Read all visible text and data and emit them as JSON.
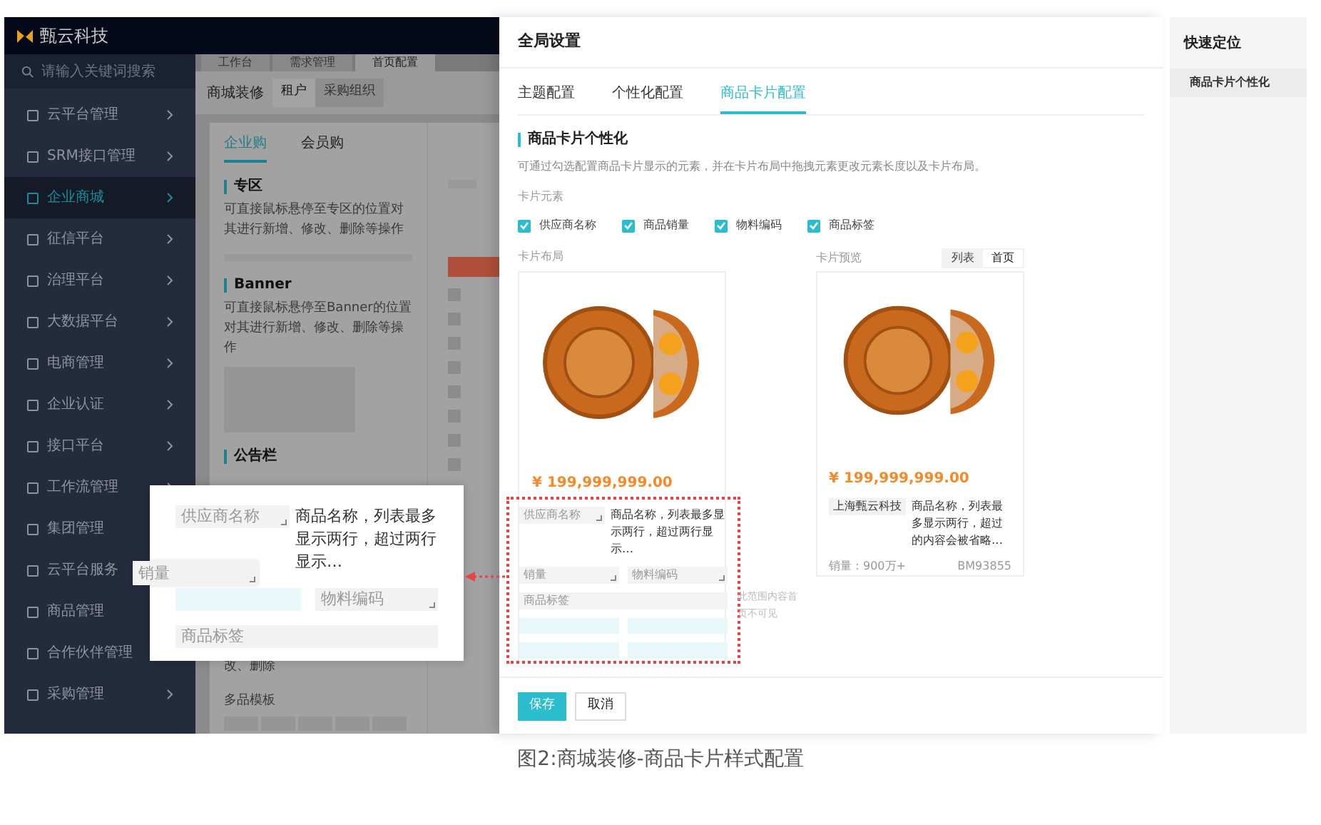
{
  "app": {
    "logo": "甄云科技",
    "search_placeholder": "请输入关键词搜索",
    "sidebar": [
      {
        "label": "云平台管理",
        "selected": false
      },
      {
        "label": "SRM接口管理",
        "selected": false
      },
      {
        "label": "企业商城",
        "selected": true
      },
      {
        "label": "征信平台",
        "selected": false
      },
      {
        "label": "治理平台",
        "selected": false
      },
      {
        "label": "大数据平台",
        "selected": false
      },
      {
        "label": "电商管理",
        "selected": false
      },
      {
        "label": "企业认证",
        "selected": false
      },
      {
        "label": "接口平台",
        "selected": false
      },
      {
        "label": "工作流管理",
        "selected": false
      },
      {
        "label": "集团管理",
        "selected": false
      },
      {
        "label": "云平台服务",
        "selected": false
      },
      {
        "label": "商品管理",
        "selected": false
      },
      {
        "label": "合作伙伴管理",
        "selected": false
      },
      {
        "label": "采购管理",
        "selected": false
      }
    ],
    "breadcrumbs": [
      {
        "label": "工作台",
        "selected": false
      },
      {
        "label": "需求管理",
        "selected": false
      },
      {
        "label": "首页配置",
        "selected": true
      }
    ],
    "page_title": "商城装修",
    "scope_tabs": [
      {
        "label": "租户",
        "selected": true
      },
      {
        "label": "采购组织",
        "selected": false
      }
    ],
    "tabs": [
      {
        "label": "企业购",
        "selected": true
      },
      {
        "label": "会员购",
        "selected": false
      }
    ],
    "sections": [
      {
        "kind": "text",
        "title": "专区",
        "description": "可直接鼠标悬停至专区的位置对其进行新增、修改、删除等操作"
      },
      {
        "kind": "image",
        "title": "Banner",
        "description": "可直接鼠标悬停至Banner的位置对其进行新增、修改、删除等操作"
      },
      {
        "kind": "title",
        "title": "公告栏"
      }
    ],
    "cut_text": "改、删除",
    "template_label": "多品模板"
  },
  "callout": {
    "supplier": "供应商名称",
    "name": "商品名称，列表最多显示两行，超过两行显示…",
    "dragged": "销量",
    "code": "物料编码",
    "tag": "商品标签"
  },
  "drawer": {
    "title": "全局设置",
    "tabs": [
      {
        "label": "主题配置",
        "selected": false
      },
      {
        "label": "个性化配置",
        "selected": false
      },
      {
        "label": "商品卡片配置",
        "selected": true
      }
    ],
    "section_title": "商品卡片个性化",
    "description": "可通过勾选配置商品卡片显示的元素，并在卡片布局中拖拽元素更改元素长度以及卡片布局。",
    "elements_label": "卡片元素",
    "elements": [
      {
        "label": "供应商名称",
        "checked": true
      },
      {
        "label": "商品销量",
        "checked": true
      },
      {
        "label": "物料编码",
        "checked": true
      },
      {
        "label": "商品标签",
        "checked": true
      }
    ],
    "layout": {
      "label": "卡片布局",
      "price": "¥ 199,999,999.00",
      "supplier": "供应商名称",
      "name": "商品名称，列表最多显示两行，超过两行显示…",
      "sales": "销量",
      "code": "物料编码",
      "tag": "商品标签",
      "hidden_note": "此范围内容首页不可见"
    },
    "preview": {
      "label": "卡片预览",
      "modes": [
        {
          "label": "列表",
          "selected": false
        },
        {
          "label": "首页",
          "selected": true
        }
      ],
      "price": "¥ 199,999,999.00",
      "supplier": "上海甄云科技",
      "name": "商品名称，列表最多显示两行，超过的内容会被省略…",
      "sales": "销量：900万+",
      "code": "BM93855"
    },
    "buttons": [
      {
        "label": "保存",
        "kind": "primary"
      },
      {
        "label": "取消",
        "kind": "default"
      }
    ]
  },
  "quick_nav": {
    "title": "快速定位",
    "items": [
      {
        "label": "商品卡片个性化",
        "selected": true
      }
    ]
  },
  "caption": "图2:商城装修-商品卡片样式配置"
}
